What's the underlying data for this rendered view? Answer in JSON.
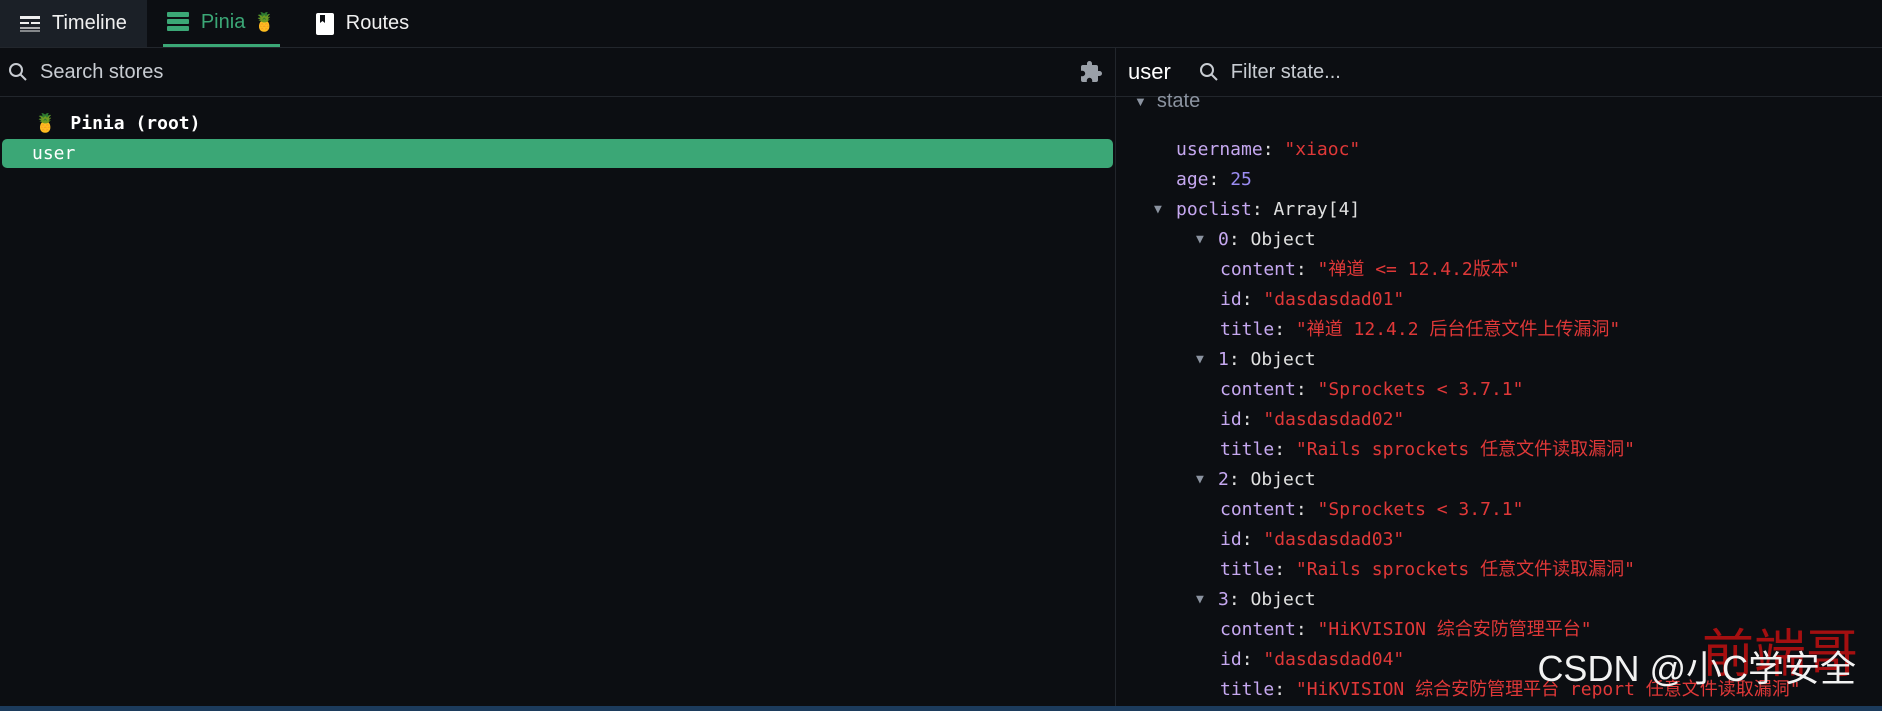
{
  "tabs": [
    {
      "label": "Timeline",
      "icon": "timeline-icon"
    },
    {
      "label": "Pinia",
      "icon": "list-icon",
      "badge": "🍍",
      "active": true
    },
    {
      "label": "Routes",
      "icon": "bookmark-icon"
    }
  ],
  "left": {
    "search_placeholder": "Search stores",
    "root": {
      "emoji": "🍍",
      "label": "Pinia (root)"
    },
    "stores": [
      {
        "label": "user",
        "selected": true
      }
    ]
  },
  "right": {
    "store_title": "user",
    "filter_placeholder": "Filter state...",
    "section": "state",
    "rows": [
      {
        "indent": 0,
        "arrow": false,
        "key": "username",
        "value": "\"xiaoc\"",
        "type": "string"
      },
      {
        "indent": 0,
        "arrow": false,
        "key": "age",
        "value": "25",
        "type": "number"
      },
      {
        "indent": 0,
        "arrow": true,
        "key": "poclist",
        "value": "Array[4]",
        "type": "type"
      },
      {
        "indent": 1,
        "arrow": true,
        "key": "0",
        "value": "Object",
        "type": "type"
      },
      {
        "indent": 2,
        "arrow": false,
        "key": "content",
        "value": "\"禅道 <= 12.4.2版本\"",
        "type": "string"
      },
      {
        "indent": 2,
        "arrow": false,
        "key": "id",
        "value": "\"dasdasdad01\"",
        "type": "string"
      },
      {
        "indent": 2,
        "arrow": false,
        "key": "title",
        "value": "\"禅道 12.4.2 后台任意文件上传漏洞\"",
        "type": "string"
      },
      {
        "indent": 1,
        "arrow": true,
        "key": "1",
        "value": "Object",
        "type": "type"
      },
      {
        "indent": 2,
        "arrow": false,
        "key": "content",
        "value": "\"Sprockets < 3.7.1\"",
        "type": "string"
      },
      {
        "indent": 2,
        "arrow": false,
        "key": "id",
        "value": "\"dasdasdad02\"",
        "type": "string"
      },
      {
        "indent": 2,
        "arrow": false,
        "key": "title",
        "value": "\"Rails sprockets 任意文件读取漏洞\"",
        "type": "string"
      },
      {
        "indent": 1,
        "arrow": true,
        "key": "2",
        "value": "Object",
        "type": "type"
      },
      {
        "indent": 2,
        "arrow": false,
        "key": "content",
        "value": "\"Sprockets < 3.7.1\"",
        "type": "string"
      },
      {
        "indent": 2,
        "arrow": false,
        "key": "id",
        "value": "\"dasdasdad03\"",
        "type": "string"
      },
      {
        "indent": 2,
        "arrow": false,
        "key": "title",
        "value": "\"Rails sprockets 任意文件读取漏洞\"",
        "type": "string"
      },
      {
        "indent": 1,
        "arrow": true,
        "key": "3",
        "value": "Object",
        "type": "type"
      },
      {
        "indent": 2,
        "arrow": false,
        "key": "content",
        "value": "\"HiKVISION 综合安防管理平台\"",
        "type": "string"
      },
      {
        "indent": 2,
        "arrow": false,
        "key": "id",
        "value": "\"dasdasdad04\"",
        "type": "string"
      },
      {
        "indent": 2,
        "arrow": false,
        "key": "title",
        "value": "\"HiKVISION 综合安防管理平台 report 任意文件读取漏洞\"",
        "type": "string"
      }
    ]
  },
  "watermark": {
    "text": "CSDN @小C学安全",
    "overlay": "前端哥"
  },
  "colors": {
    "accent": "#3ba776",
    "key": "#c6a8f0",
    "string": "#e03838",
    "number": "#9b8cf2",
    "background": "#0c0e12"
  }
}
